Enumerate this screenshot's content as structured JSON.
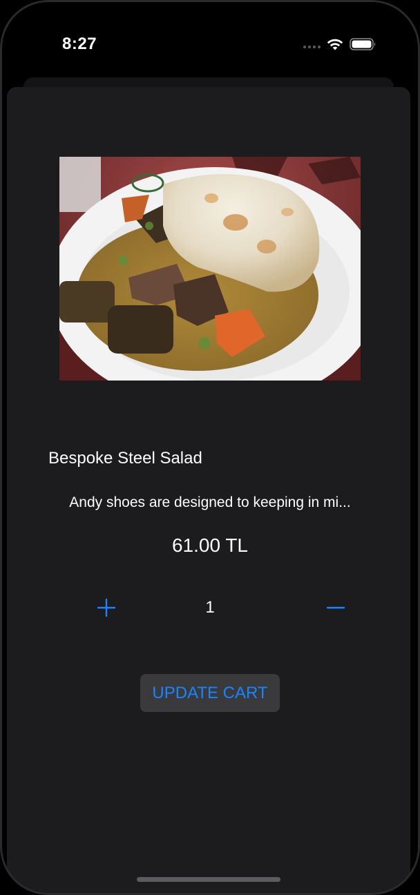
{
  "status_bar": {
    "time": "8:27"
  },
  "product": {
    "image_alt": "Plate of meat stew with vegetables and melted cheese",
    "name": "Bespoke Steel Salad",
    "description": "Andy shoes are designed to keeping in mi...",
    "price": "61.00 TL"
  },
  "quantity": {
    "value": "1",
    "increment_icon": "plus-icon",
    "decrement_icon": "minus-icon"
  },
  "actions": {
    "update_label": "UPDATE CART"
  },
  "colors": {
    "accent": "#1a84ff",
    "sheet_background": "#1c1c1e",
    "button_background": "#3a3a3c"
  }
}
